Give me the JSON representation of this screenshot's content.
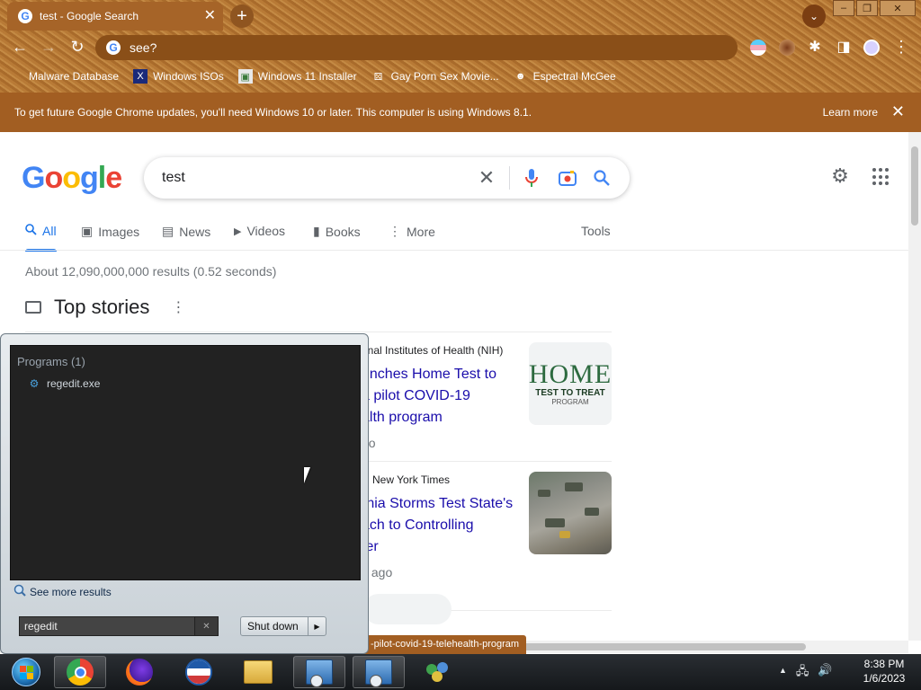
{
  "browser": {
    "tab_title": "test - Google Search",
    "tab_close": "✕",
    "new_tab": "+",
    "tab_search": "⌄",
    "window_buttons": [
      "–",
      "❐",
      "✕"
    ],
    "address": "see?",
    "bookmarks": [
      {
        "label": "Malware Database",
        "icon": "blank-icon"
      },
      {
        "label": "Windows ISOs",
        "icon": "x-logo-icon"
      },
      {
        "label": "Windows 11 Installer",
        "icon": "image-icon"
      },
      {
        "label": "Gay Porn Sex Movie...",
        "icon": "dice-icon"
      },
      {
        "label": "Espectral McGee",
        "icon": "avatar-icon"
      }
    ],
    "infobar": {
      "message": "To get future Google Chrome updates, you'll need Windows 10 or later. This computer is using Windows 8.1.",
      "learn_more": "Learn more",
      "close": "✕"
    },
    "status_url": "-pilot-covid-19-telehealth-program",
    "theme_color": "#a25e22"
  },
  "google": {
    "logo": [
      "G",
      "o",
      "o",
      "g",
      "l",
      "e"
    ],
    "logo_colors": [
      "#4285f4",
      "#ea4335",
      "#fbbc05",
      "#4285f4",
      "#34a853",
      "#ea4335"
    ],
    "query": "test",
    "tabs": [
      {
        "label": "All",
        "icon": "search-icon",
        "glyph": "🔍"
      },
      {
        "label": "Images",
        "icon": "image-icon",
        "glyph": "▣"
      },
      {
        "label": "News",
        "icon": "newspaper-icon",
        "glyph": "▤"
      },
      {
        "label": "Videos",
        "icon": "play-icon",
        "glyph": "▶"
      },
      {
        "label": "Books",
        "icon": "book-icon",
        "glyph": "▮"
      },
      {
        "label": "More",
        "icon": "more-vert-icon",
        "glyph": "⋮"
      }
    ],
    "tools": "Tools",
    "stats": "About 12,090,000,000 results (0.52 seconds)",
    "top_stories": "Top stories",
    "stories": [
      {
        "source": "onal Institutes of Health (NIH)",
        "title_lines": [
          "unches Home Test to",
          "a pilot COVID-19",
          "alth program"
        ],
        "time": "go",
        "thumb": {
          "h": "HOME",
          "t": "TEST TO TREAT",
          "p": "PROGRAM"
        }
      },
      {
        "source": "New York Times",
        "title_lines": [
          "rnia Storms Test State's",
          "ach to Controlling",
          "ter"
        ],
        "time": "s ago"
      }
    ]
  },
  "start_menu": {
    "heading": "Programs (1)",
    "item": "regedit.exe",
    "see_more": "See more results",
    "search_value": "regedit",
    "clear": "✕",
    "shutdown": "Shut down",
    "shutdown_arrow": "▶"
  },
  "taskbar": {
    "apps": [
      "start-orb",
      "chrome",
      "firefox",
      "obama",
      "explorer",
      "regedit",
      "regedit-2",
      "users"
    ],
    "clock_time": "8:38 PM",
    "clock_date": "1/6/2023",
    "tray": [
      "▲",
      "🖧",
      "🔊"
    ]
  }
}
